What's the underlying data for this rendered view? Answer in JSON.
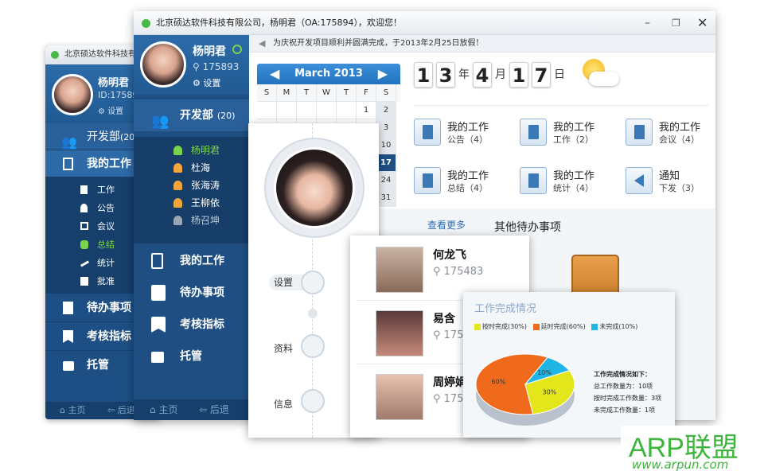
{
  "back_window": {
    "title": "北京硕达软件科技有",
    "user_name": "杨明君",
    "user_id": "ID:175894",
    "settings": "设置",
    "dept": "开发部",
    "dept_count": "(20",
    "my_work": "我的工作",
    "sub_items": [
      "工作",
      "公告",
      "会议",
      "总结",
      "统计",
      "批准"
    ],
    "menu": [
      "待办事项",
      "考核指标",
      "托管"
    ],
    "footer": [
      "主页",
      "后退"
    ]
  },
  "main_window": {
    "title": "北京硕达软件科技有限公司，杨明君（OA:175894），欢迎您！",
    "user_name": "杨明君",
    "user_id": "175893",
    "settings": "设置",
    "dept": "开发部",
    "dept_count": "(20)",
    "contacts": [
      "杨明君",
      "杜海",
      "张海涛",
      "王柳依",
      "杨召坤"
    ],
    "menu": [
      "我的工作",
      "待办事项",
      "考核指标",
      "托管"
    ],
    "footer": [
      "主页",
      "后退"
    ],
    "notice": "为庆祝开发项目顺利并圆满完成，于2013年2月25日放假！",
    "calendar": {
      "month": "March 2013",
      "weekdays": [
        "S",
        "M",
        "T",
        "W",
        "T",
        "F",
        "S"
      ],
      "visible_days": [
        "1",
        "2",
        "3",
        "10",
        "17",
        "24",
        "31"
      ],
      "today": "17"
    },
    "date": {
      "year_digits": [
        "1",
        "3"
      ],
      "year_unit": "年",
      "month_digit": "4",
      "month_unit": "月",
      "day_digits": [
        "1",
        "7"
      ],
      "day_unit": "日"
    },
    "work_items": [
      {
        "title": "我的工作",
        "sub": "公告（4）"
      },
      {
        "title": "我的工作",
        "sub": "工作（2）"
      },
      {
        "title": "我的工作",
        "sub": "会议（4）"
      },
      {
        "title": "我的工作",
        "sub": "总结（4）"
      },
      {
        "title": "我的工作",
        "sub": "统计（4）"
      },
      {
        "title": "通知",
        "sub": "下发（3）"
      }
    ],
    "see_more": "查看更多",
    "other_tasks": "其他待办事项"
  },
  "side_panel": {
    "items": [
      "设置",
      "资料",
      "信息"
    ]
  },
  "contacts_panel": {
    "people": [
      {
        "name": "何龙飞",
        "id": "175483"
      },
      {
        "name": "易含",
        "id": "175"
      },
      {
        "name": "周婷娟",
        "id": "175"
      }
    ]
  },
  "chart_panel": {
    "title": "工作完成情况",
    "summary_title": "工作完成情况如下：",
    "summary_lines": [
      "总工作数量为：10项",
      "按时完成工作数量：3项",
      "未完成工作数量：1项"
    ]
  },
  "chart_data": {
    "type": "pie",
    "categories": [
      "按时完成(30%)",
      "延时完成(60%)",
      "未完成(10%)"
    ],
    "values": [
      30,
      60,
      10
    ],
    "slice_labels": [
      "30%",
      "60%",
      "10%"
    ],
    "colors": [
      "#e2e61a",
      "#f06a1c",
      "#1fb6e6"
    ]
  },
  "watermark": {
    "brand": "ARP联盟",
    "url": "www.arpun.com"
  },
  "colors": {
    "primary_blue": "#1f4f82",
    "accent_blue": "#2272be",
    "green": "#3bb63b"
  }
}
